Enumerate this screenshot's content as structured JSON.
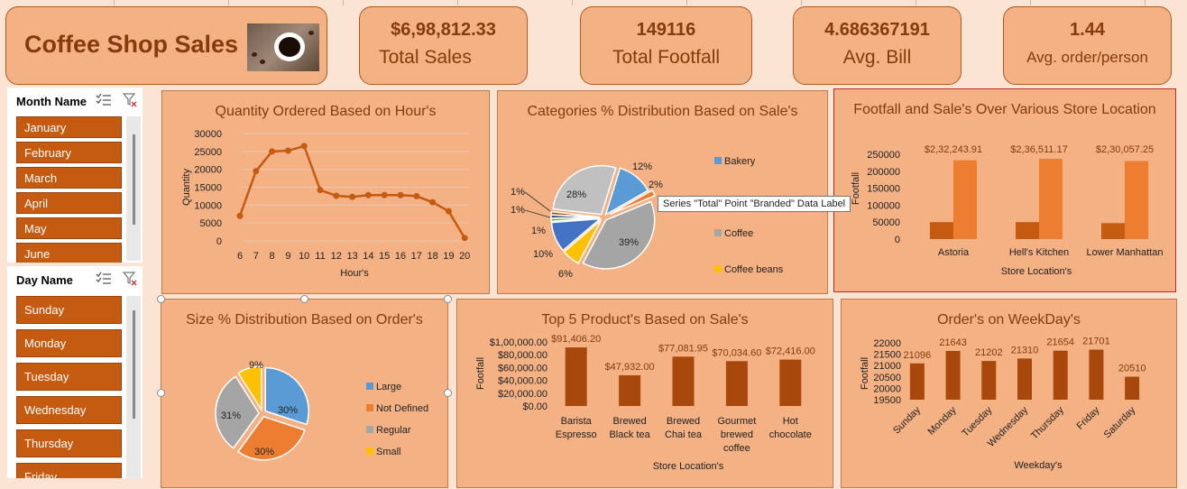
{
  "title": {
    "text": "Coffee Shop Sales",
    "image": "coffee-cup-photo"
  },
  "kpis": [
    {
      "value": "$6,98,812.33",
      "label": "Total Sales"
    },
    {
      "value": "149116",
      "label": "Total Footfall"
    },
    {
      "value": "4.686367191",
      "label": "Avg. Bill"
    },
    {
      "value": "1.44",
      "label": "Avg. order/person"
    }
  ],
  "month_slicer": {
    "title": "Month Name",
    "items": [
      "January",
      "February",
      "March",
      "April",
      "May",
      "June"
    ]
  },
  "day_slicer": {
    "title": "Day Name",
    "items": [
      "Sunday",
      "Monday",
      "Tuesday",
      "Wednesday",
      "Thursday",
      "Friday"
    ]
  },
  "icons": {
    "multiselect": "multi-select-icon",
    "clear": "clear-filter-icon"
  },
  "colors": {
    "accent": "#c55a11",
    "panel": "#f4b183",
    "bar": "#a9480c",
    "orange": "#ed7d31",
    "gray": "#a5a5a5",
    "blue": "#5b9bd5",
    "gold": "#ffc000",
    "darkblue": "#4472c4"
  },
  "tooltip": "Series \"Total\" Point \"Branded\" Data Label",
  "chart_data": [
    {
      "type": "line",
      "title": "Quantity Ordered Based on Hour's",
      "xlabel": "Hour's",
      "ylabel": "Quantity",
      "x": [
        6,
        7,
        8,
        9,
        10,
        11,
        12,
        13,
        14,
        15,
        16,
        17,
        18,
        19,
        20
      ],
      "values": [
        7000,
        19500,
        25000,
        25200,
        26500,
        14200,
        12600,
        12300,
        12800,
        12800,
        12800,
        12500,
        10800,
        8300,
        800
      ],
      "ylim": [
        0,
        30000
      ],
      "yticks": [
        "0",
        "5000",
        "10000",
        "15000",
        "20000",
        "25000",
        "30000"
      ]
    },
    {
      "type": "pie",
      "title": "Categories % Distribution Based on Sale's",
      "slices": [
        {
          "name": "Bakery",
          "label": "12%",
          "value": 12
        },
        {
          "name": "Branded",
          "label": "2%",
          "value": 2
        },
        {
          "name": "",
          "label": "39%",
          "value": 39
        },
        {
          "name": "Coffee beans",
          "label": "6%",
          "value": 6
        },
        {
          "name": "",
          "label": "10%",
          "value": 10
        },
        {
          "name": "",
          "label": "1%",
          "value": 1
        },
        {
          "name": "",
          "label": "1%",
          "value": 1
        },
        {
          "name": "",
          "label": "1%",
          "value": 1
        },
        {
          "name": "",
          "label": "28%",
          "value": 28
        }
      ],
      "legend": [
        "Bakery",
        "Coffee",
        "Coffee beans"
      ]
    },
    {
      "type": "bar",
      "title": "Footfall and Sale's Over Various Store Location",
      "xlabel": "Store Location's",
      "ylabel": "Footfall",
      "categories": [
        "Astoria",
        "Hell's Kitchen",
        "Lower Manhattan"
      ],
      "series": [
        {
          "name": "",
          "values": [
            50000,
            50000,
            47000
          ]
        },
        {
          "name": "",
          "values": [
            232243.91,
            236511.17,
            230057.25
          ],
          "labels": [
            "$2,32,243.91",
            "$2,36,511.17",
            "$2,30,057.25"
          ]
        }
      ],
      "ylim": [
        0,
        250000
      ],
      "yticks": [
        "0",
        "50000",
        "100000",
        "150000",
        "200000",
        "250000"
      ]
    },
    {
      "type": "pie",
      "title": "Size % Distribution Based on Order's",
      "slices": [
        {
          "name": "Large",
          "label": "30%",
          "value": 30
        },
        {
          "name": "Not Defined",
          "label": "30%",
          "value": 30
        },
        {
          "name": "Regular",
          "label": "31%",
          "value": 31
        },
        {
          "name": "Small",
          "label": "9%",
          "value": 9
        }
      ],
      "legend": [
        "Large",
        "Not Defined",
        "Regular",
        "Small"
      ]
    },
    {
      "type": "bar",
      "title": "Top 5 Product's Based on Sale's",
      "xlabel": "Store Location's",
      "ylabel": "Footfall",
      "categories": [
        "Barista Espresso",
        "Brewed Black tea",
        "Brewed Chai tea",
        "Gourmet brewed coffee",
        "Hot chocolate"
      ],
      "values": [
        91406.2,
        47932.0,
        77081.95,
        70034.6,
        72416.0
      ],
      "labels": [
        "$91,406.20",
        "$47,932.00",
        "$77,081.95",
        "$70,034.60",
        "$72,416.00"
      ],
      "ylim": [
        0,
        100000
      ],
      "yticks": [
        "$0.00",
        "$20,000.00",
        "$40,000.00",
        "$60,000.00",
        "$80,000.00",
        "$1,00,000.00"
      ]
    },
    {
      "type": "bar",
      "title": "Order's on WeekDay's",
      "xlabel": "Weekday's",
      "ylabel": "Footfall",
      "categories": [
        "Sunday",
        "Monday",
        "Tuesday",
        "Wednesday",
        "Thursday",
        "Friday",
        "Saturday"
      ],
      "values": [
        21096,
        21643,
        21202,
        21310,
        21654,
        21701,
        20510
      ],
      "ylim": [
        19500,
        22000
      ],
      "yticks": [
        "19500",
        "20000",
        "20500",
        "21000",
        "21500",
        "22000"
      ]
    }
  ]
}
